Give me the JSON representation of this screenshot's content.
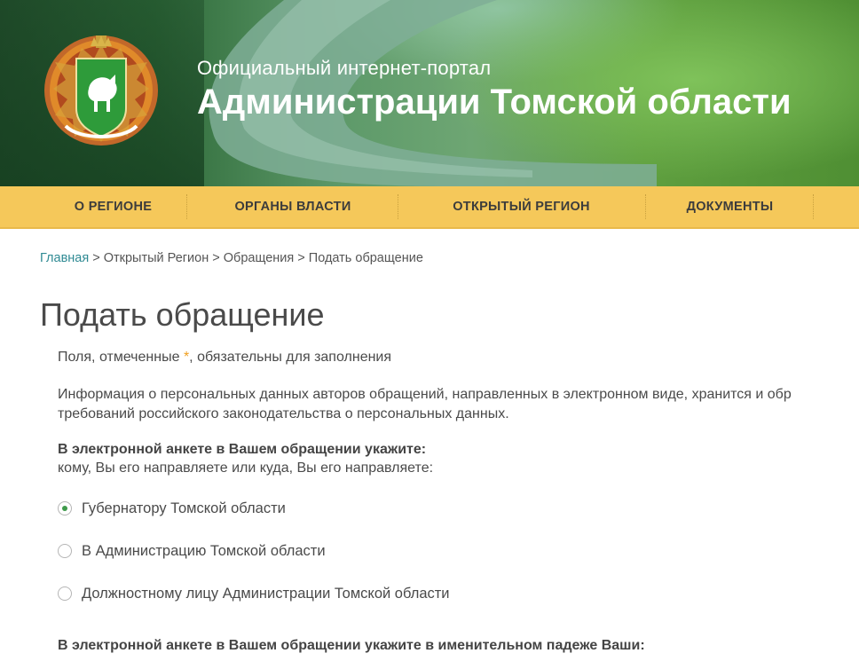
{
  "header": {
    "subtitle": "Официальный интернет-портал",
    "title": "Администрации Томской области"
  },
  "nav": {
    "items": [
      "О РЕГИОНЕ",
      "ОРГАНЫ ВЛАСТИ",
      "ОТКРЫТЫЙ РЕГИОН",
      "ДОКУМЕНТЫ"
    ]
  },
  "breadcrumb": {
    "home": "Главная",
    "rest": " > Открытый Регион > Обращения > Подать обращение"
  },
  "page": {
    "heading": "Подать обращение",
    "required_prefix": "Поля, отмеченные ",
    "required_mark": "*",
    "required_suffix": ", обязательны для заполнения",
    "info_line1": "Информация о персональных данных авторов обращений, направленных в электронном виде, хранится и обр",
    "info_line2": "требований российского законодательства о персональных данных.",
    "question_bold": "В электронной анкете в Вашем обращении укажите:",
    "question_sub": "кому, Вы его направляете или куда, Вы его направляете:",
    "options": [
      {
        "label": "Губернатору Томской области",
        "checked": true
      },
      {
        "label": "В Администрацию Томской области",
        "checked": false
      },
      {
        "label": "Должностному лицу Администрации Томской области",
        "checked": false
      }
    ],
    "name_section": "В электронной анкете в Вашем обращении укажите в именительном падеже Ваши:"
  }
}
